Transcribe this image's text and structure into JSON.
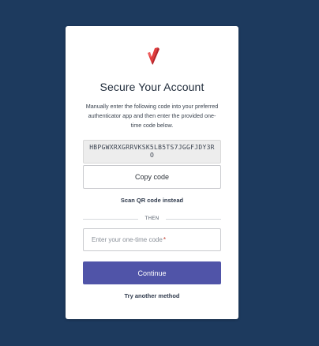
{
  "logo": {
    "icon": "brand-shield-check-icon",
    "colors": [
      "#e23b3b",
      "#b5252a",
      "#ffffff"
    ]
  },
  "title": "Secure Your Account",
  "description": "Manually enter the following code into your preferred authenticator app and then enter the provided one-time code below.",
  "secret_code": "HBPGWXRXGRRVKSK5LB5TS7JGGFJDY3RO",
  "copy_button": {
    "label": "Copy code"
  },
  "qr_link": {
    "label": "Scan QR code instead"
  },
  "divider_label": "THEN",
  "otp_field": {
    "placeholder": "Enter your one-time code",
    "required_marker": "*",
    "value": ""
  },
  "continue_button": {
    "label": "Continue"
  },
  "alt_method_link": {
    "label": "Try another method"
  },
  "colors": {
    "background": "#1d3a5e",
    "card": "#ffffff",
    "primary": "#5054a8",
    "code_box": "#ededed",
    "required": "#c03a2b"
  }
}
